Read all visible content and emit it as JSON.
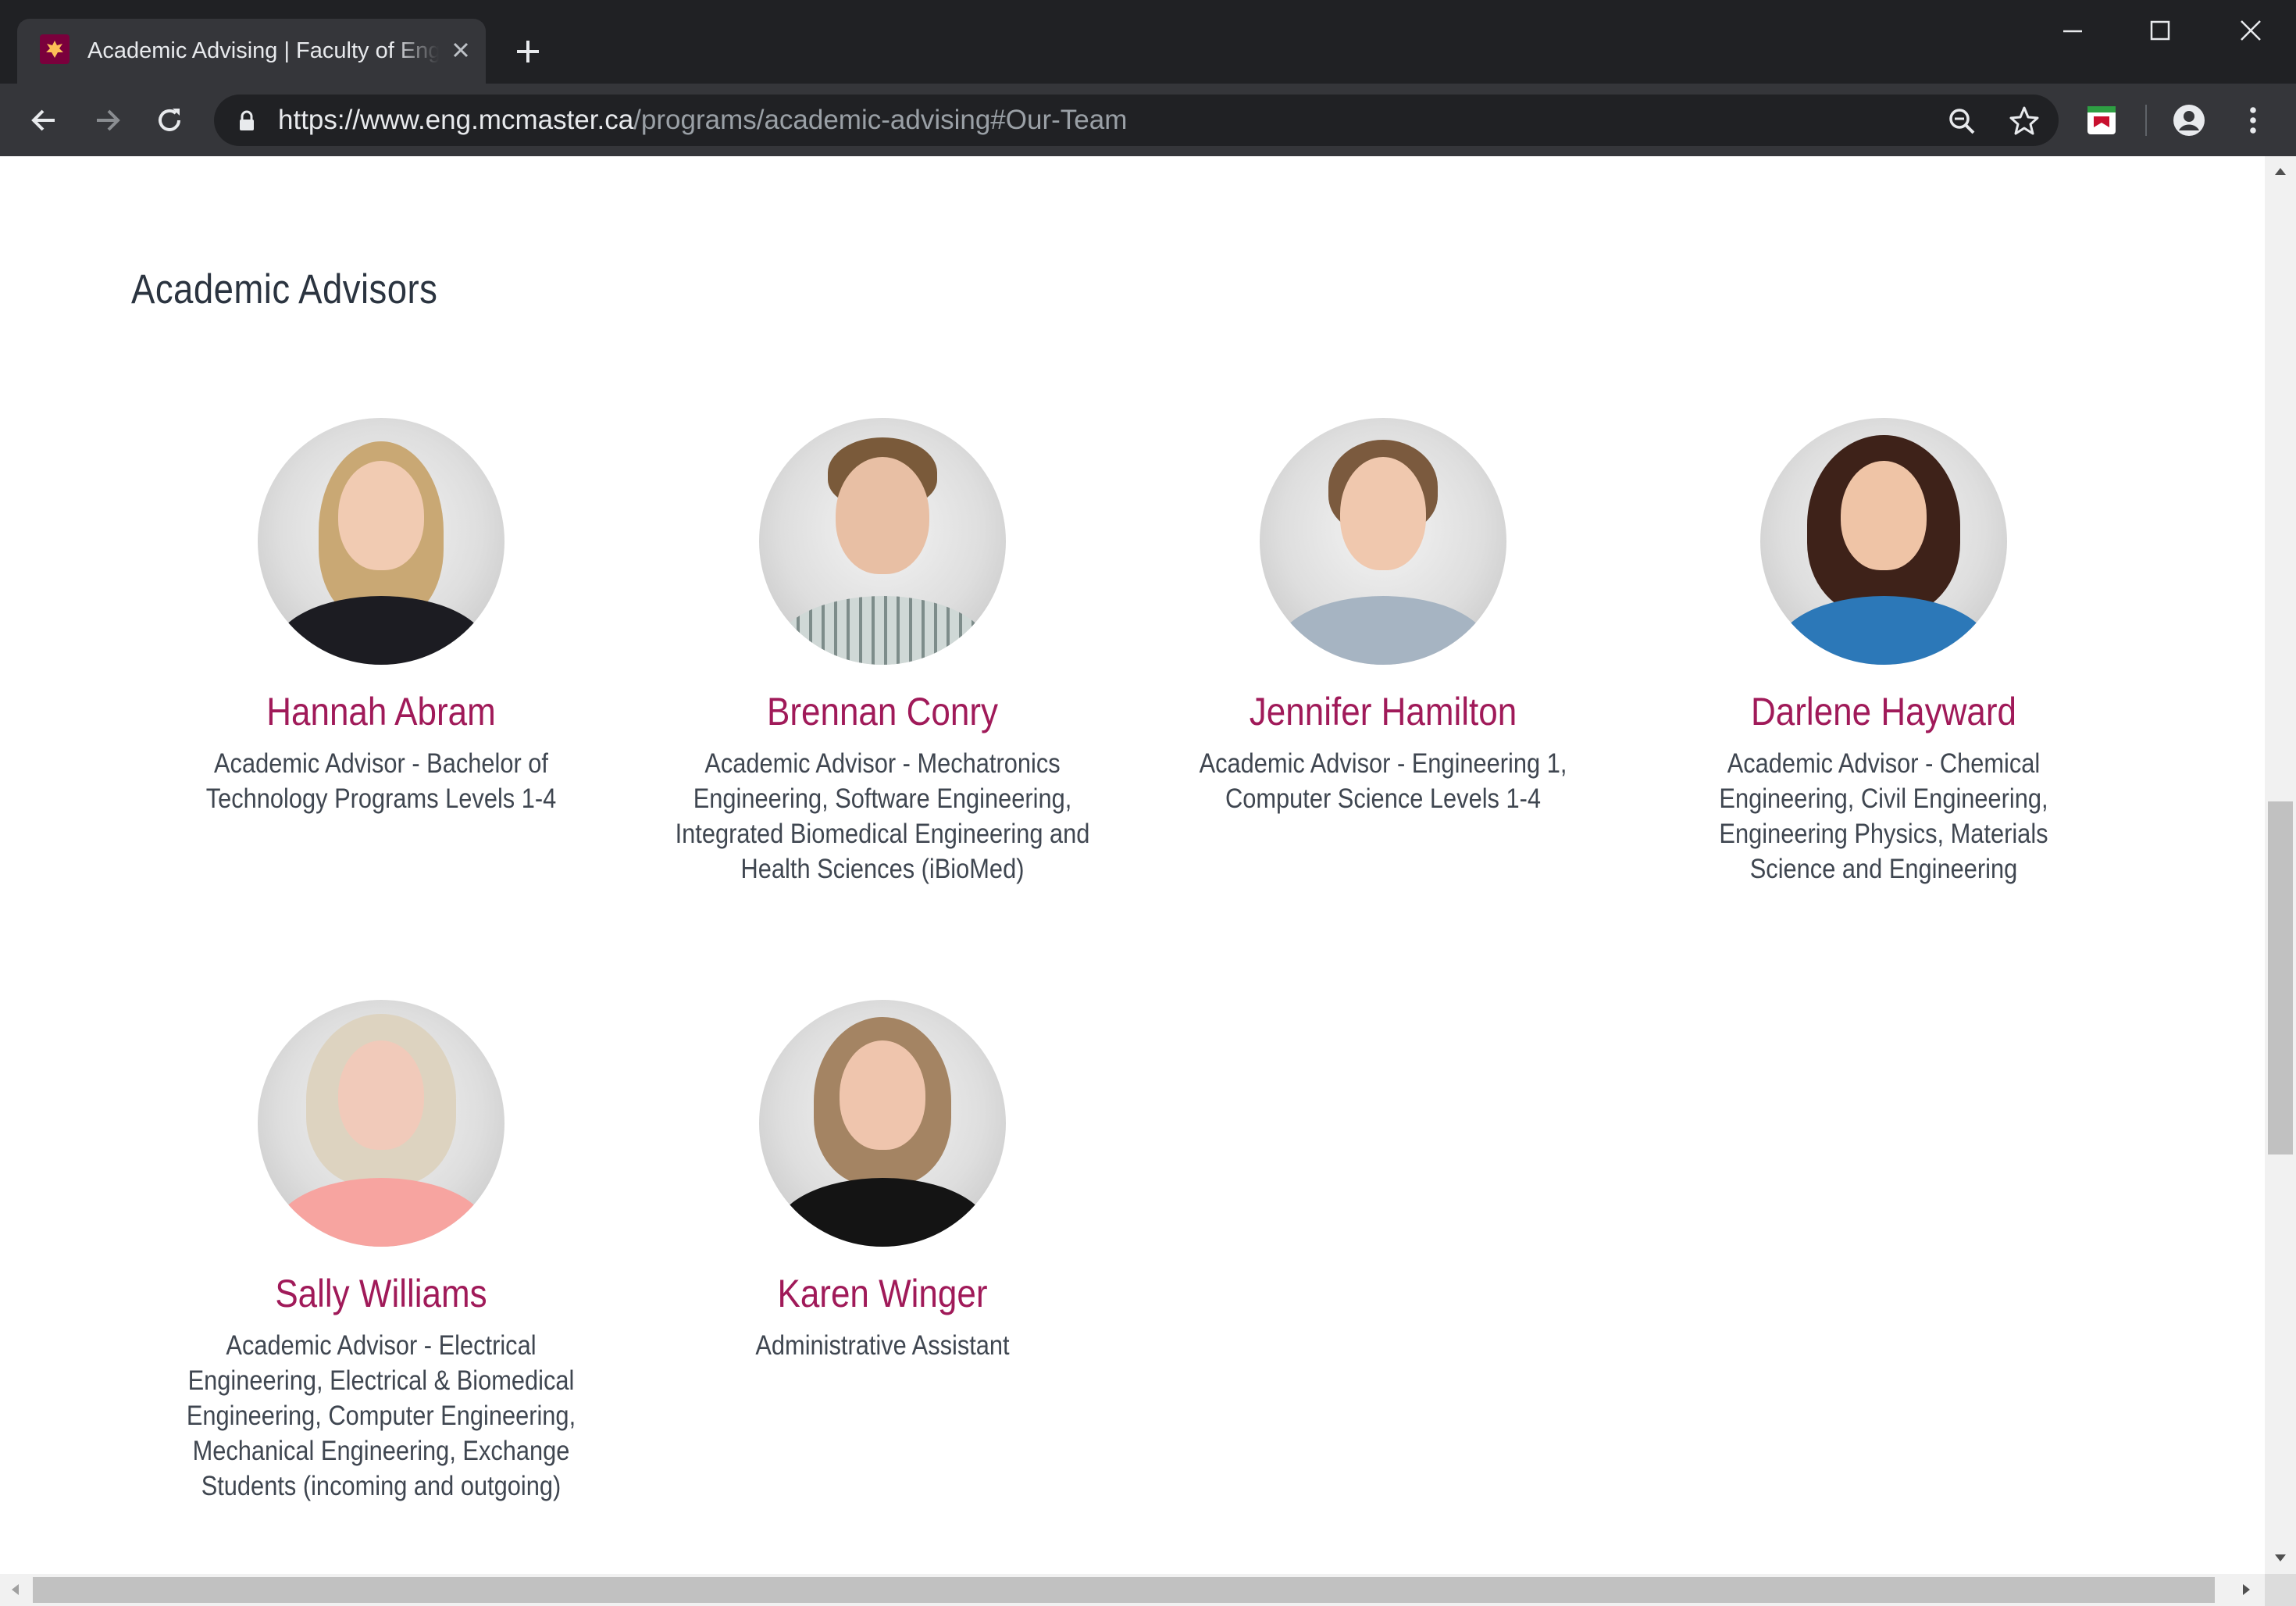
{
  "browser": {
    "tab_title": "Academic Advising | Faculty of Engineering",
    "url_main": "https://www.eng.mcmaster.ca",
    "url_path": "/programs/academic-advising#Our-Team"
  },
  "page": {
    "section_title": "Academic Advisors",
    "advisors": [
      {
        "name": "Hannah Abram",
        "role": "Academic Advisor - Bachelor of Technology Programs Levels 1-4"
      },
      {
        "name": "Brennan Conry",
        "role": "Academic Advisor - Mechatronics Engineering, Software Engineering, Integrated Biomedical Engineering and Health Sciences (iBioMed)"
      },
      {
        "name": "Jennifer Hamilton",
        "role": "Academic Advisor - Engineering 1, Computer Science Levels 1-4"
      },
      {
        "name": "Darlene Hayward",
        "role": "Academic Advisor - Chemical Engineering, Civil Engineering, Engineering Physics, Materials Science and Engineering"
      },
      {
        "name": "Sally Williams",
        "role": "Academic Advisor - Electrical Engineering, Electrical & Biomedical Engineering, Computer Engineering, Mechanical Engineering, Exchange Students (incoming and outgoing)"
      },
      {
        "name": "Karen Winger",
        "role": "Administrative Assistant"
      }
    ]
  },
  "colors": {
    "name_accent": "#a01a59",
    "heading": "#2b3440",
    "chrome_dark": "#202124",
    "chrome_toolbar": "#35363a"
  },
  "icons": [
    "mcmaster-favicon-icon",
    "close-icon",
    "plus-icon",
    "minimize-icon",
    "maximize-icon",
    "back-icon",
    "forward-icon",
    "reload-icon",
    "lock-icon",
    "zoom-icon",
    "star-icon",
    "extension-icon",
    "profile-icon",
    "menu-icon"
  ]
}
